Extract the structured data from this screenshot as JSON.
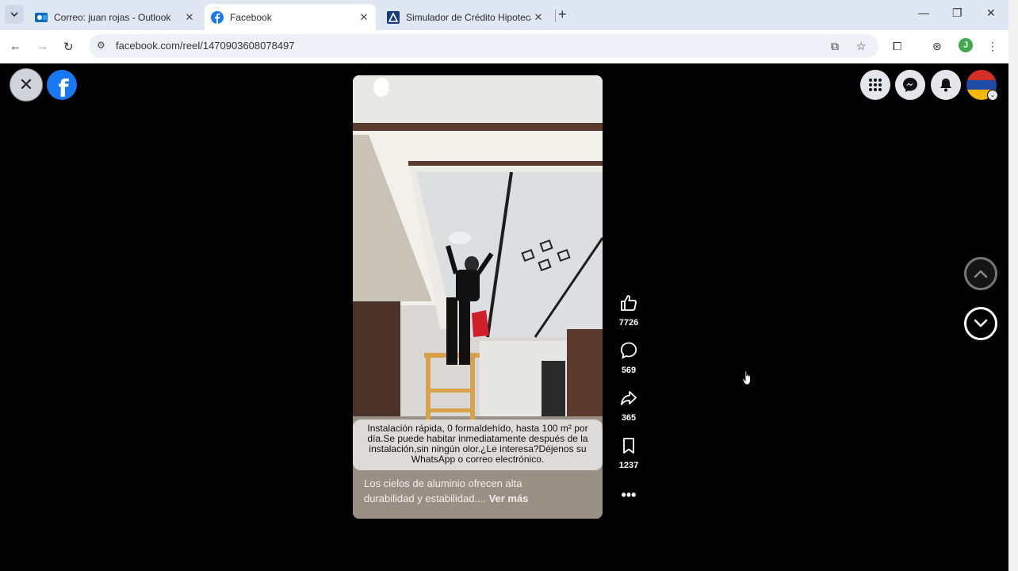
{
  "tabs": [
    {
      "title": "Correo: juan rojas - Outlook"
    },
    {
      "title": "Facebook"
    },
    {
      "title": "Simulador de Crédito Hipoteca"
    }
  ],
  "address_bar": {
    "url": "facebook.com/reel/1470903608078497"
  },
  "profile_initial": "J",
  "reel": {
    "overlay_text": "Instalación rápida, 0 formaldehído, hasta 100 m² por día.Se puede habitar inmediatamente después de la instalación,sin ningún olor.¿Le interesa?Déjenos su WhatsApp o correo electrónico.",
    "caption": "Los cielos de aluminio ofrecen alta durabilidad y estabilidad....",
    "see_more": "Ver más",
    "actions": {
      "likes": "7726",
      "comments": "569",
      "shares": "365",
      "saves": "1237"
    }
  },
  "colors": {
    "fb_blue": "#1877f2",
    "tab_strip": "#dfe7f3",
    "video_ceiling": "#e9e9e6"
  }
}
